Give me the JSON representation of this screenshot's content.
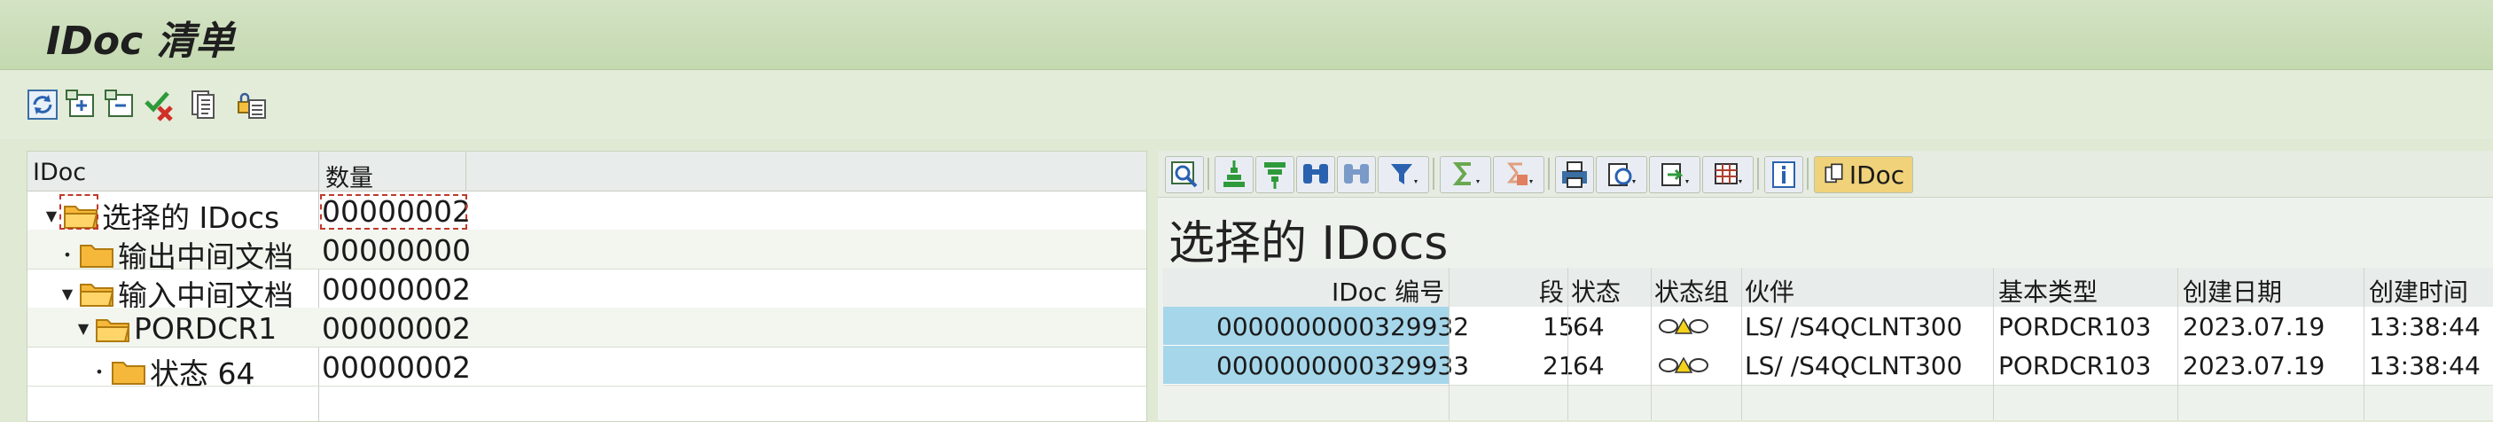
{
  "window": {
    "title": "IDoc 清单"
  },
  "toolbar": {
    "icons": [
      "refresh-icon",
      "expand-icon",
      "collapse-icon",
      "check-cancel-icon",
      "document-icon",
      "lock-list-icon"
    ]
  },
  "tree": {
    "headers": {
      "idoc": "IDoc",
      "count": "数量"
    },
    "rows": [
      {
        "label": "选择的 IDocs",
        "count": "00000002",
        "toggle": "▼",
        "level": 0
      },
      {
        "label": "输出中间文档",
        "count": "00000000",
        "toggle": "•",
        "level": 1
      },
      {
        "label": "输入中间文档",
        "count": "00000002",
        "toggle": "▼",
        "level": 1
      },
      {
        "label": "PORDCR1",
        "count": "00000002",
        "toggle": "▼",
        "level": 2
      },
      {
        "label": "状态 64",
        "count": "00000002",
        "toggle": "•",
        "level": 3
      }
    ]
  },
  "alv": {
    "idoc_button_label": "IDoc",
    "title": "选择的 IDocs",
    "columns": {
      "idoc_no": "IDoc 编号",
      "segment": "段",
      "status": "状态",
      "status_group": "状态组",
      "partner": "伙伴",
      "basic_type": "基本类型",
      "created_date": "创建日期",
      "created_time": "创建时间"
    },
    "rows": [
      {
        "idoc_no": "0000000000329932",
        "segment": "15",
        "status": "64",
        "partner": "LS/  /S4QCLNT300",
        "basic_type": "PORDCR103",
        "created_date": "2023.07.19",
        "created_time": "13:38:44"
      },
      {
        "idoc_no": "0000000000329933",
        "segment": "21",
        "status": "64",
        "partner": "LS/  /S4QCLNT300",
        "basic_type": "PORDCR103",
        "created_date": "2023.07.19",
        "created_time": "13:38:44"
      }
    ]
  },
  "colors": {
    "title_bar": "#c8dcb4",
    "selected_cell": "#a6d6ea",
    "folder": "#f5b83a"
  }
}
